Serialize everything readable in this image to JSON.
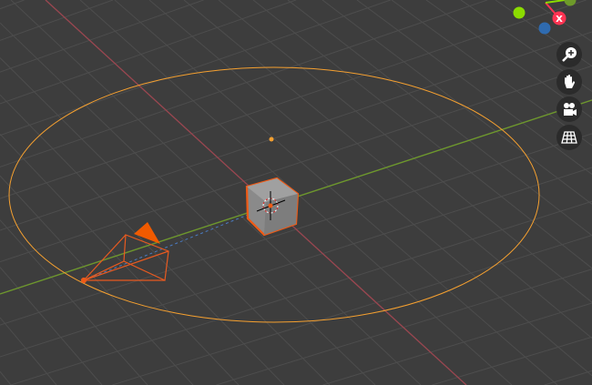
{
  "viewport": {
    "gizmo": {
      "x_label": "X",
      "x_color": "#ff3352",
      "y_color": "#8bdc00",
      "z_color": "#2f6bb0"
    },
    "nav_buttons": [
      {
        "icon": "zoom-icon"
      },
      {
        "icon": "hand-pan-icon"
      },
      {
        "icon": "camera-view-icon"
      },
      {
        "icon": "ortho-grid-icon"
      }
    ],
    "colors": {
      "selection": "#f05a14",
      "light": "#f5a030",
      "x_axis": "#b0454f",
      "y_axis": "#6e9a2a"
    }
  }
}
